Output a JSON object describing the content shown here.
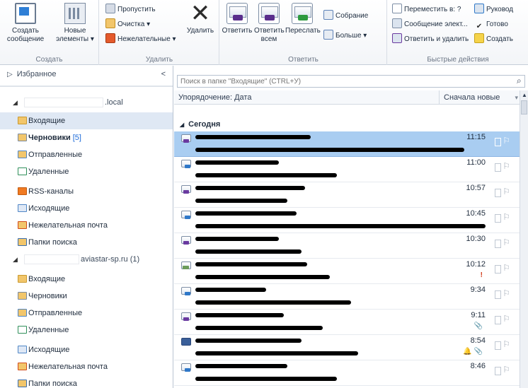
{
  "ribbon": {
    "groups": {
      "create": "Создать",
      "delete": "Удалить",
      "reply": "Ответить",
      "quick_steps": "Быстрые действия"
    },
    "buttons": {
      "new_message": "Создать сообщение",
      "new_items": "Новые элементы ▾",
      "ignore": "Пропустить",
      "clean_up": "Очистка ▾",
      "junk": "Нежелательные ▾",
      "delete": "Удалить",
      "reply": "Ответить",
      "reply_all": "Ответить всем",
      "forward": "Переслать",
      "meeting": "Собрание",
      "more": "Больше ▾",
      "move_to": "Переместить в: ?",
      "email_team": "Сообщение элект...",
      "reply_delete": "Ответить и удалить",
      "to_manager": "Руковод",
      "done": "Готово",
      "create_new": "Создать"
    }
  },
  "folder_pane": {
    "favorites": "Избранное",
    "collapse_glyph": "<",
    "accounts": [
      {
        "name": ".local",
        "folders": [
          {
            "label": "Входящие",
            "badge": ""
          },
          {
            "label": "Черновики",
            "badge": "[5]"
          },
          {
            "label": "Отправленные",
            "badge": ""
          },
          {
            "label": "Удаленные",
            "badge": ""
          },
          {
            "label": "RSS-каналы",
            "badge": ""
          },
          {
            "label": "Исходящие",
            "badge": ""
          },
          {
            "label": "Нежелательная почта",
            "badge": ""
          },
          {
            "label": "Папки поиска",
            "badge": ""
          }
        ]
      },
      {
        "name": "aviastar-sp.ru (1)",
        "folders": [
          {
            "label": "Входящие",
            "badge": ""
          },
          {
            "label": "Черновики",
            "badge": ""
          },
          {
            "label": "Отправленные",
            "badge": ""
          },
          {
            "label": "Удаленные",
            "badge": ""
          },
          {
            "label": "Исходящие",
            "badge": ""
          },
          {
            "label": "Нежелательная почта",
            "badge": ""
          },
          {
            "label": "Папки поиска",
            "badge": ""
          }
        ]
      }
    ]
  },
  "message_list": {
    "search_placeholder": "Поиск в папке \"Входящие\" (CTRL+У)",
    "sort_by": "Упорядочение: Дата",
    "sort_order": "Сначала новые",
    "group_label": "Сегодня",
    "messages": [
      {
        "time": "11:15",
        "extra": "",
        "icon": "reply"
      },
      {
        "time": "11:00",
        "extra": "",
        "icon": "fwd"
      },
      {
        "time": "10:57",
        "extra": "",
        "icon": "reply"
      },
      {
        "time": "10:45",
        "extra": "",
        "icon": "fwd"
      },
      {
        "time": "10:30",
        "extra": "",
        "icon": "reply"
      },
      {
        "time": "10:12",
        "extra": "!",
        "icon": "ok"
      },
      {
        "time": "9:34",
        "extra": "",
        "icon": "fwd"
      },
      {
        "time": "9:11",
        "extra": "📎",
        "icon": "reply"
      },
      {
        "time": "8:54",
        "extra": "🔔 📎",
        "icon": "app"
      },
      {
        "time": "8:46",
        "extra": "",
        "icon": "fwd"
      }
    ]
  }
}
